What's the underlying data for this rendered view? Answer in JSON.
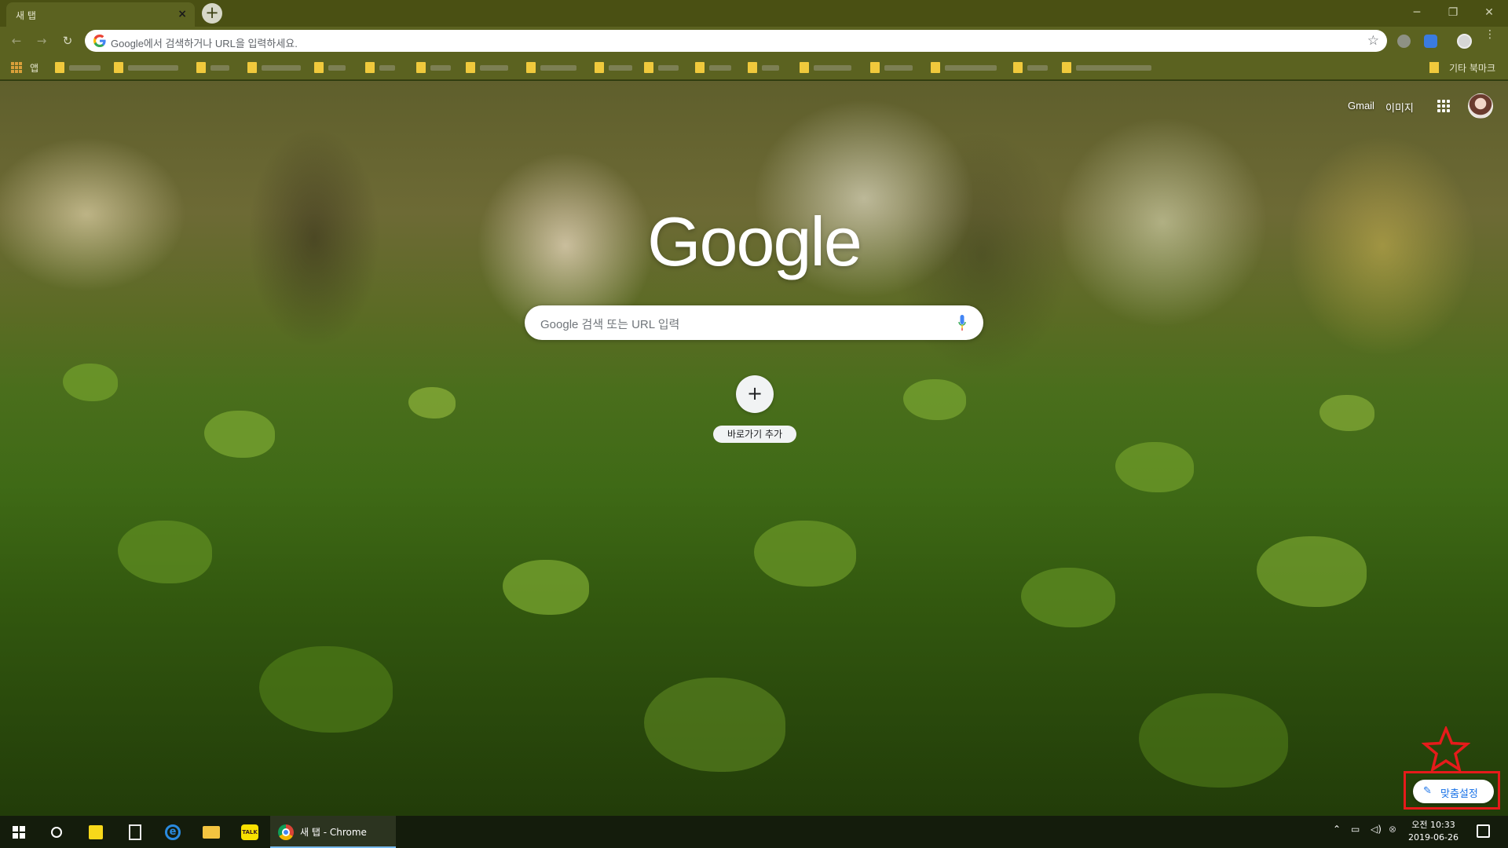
{
  "browser": {
    "tab_title": "새 탭",
    "omnibox_placeholder": "Google에서 검색하거나 URL을 입력하세요.",
    "apps_label": "앱",
    "other_bookmarks": "기타 북마크"
  },
  "ntp": {
    "gmail": "Gmail",
    "images": "이미지",
    "logo": "Google",
    "search_placeholder": "Google 검색 또는 URL 입력",
    "add_shortcut": "바로가기 추가",
    "customize": "맞춤설정"
  },
  "taskbar": {
    "chrome_label": "새 탭 - Chrome",
    "clock_time": "오전 10:33",
    "clock_date": "2019-06-26"
  },
  "colors": {
    "accent": "#1a73e8",
    "highlight_frame": "#e61b1b",
    "chrome_frame": "#4a5013"
  }
}
